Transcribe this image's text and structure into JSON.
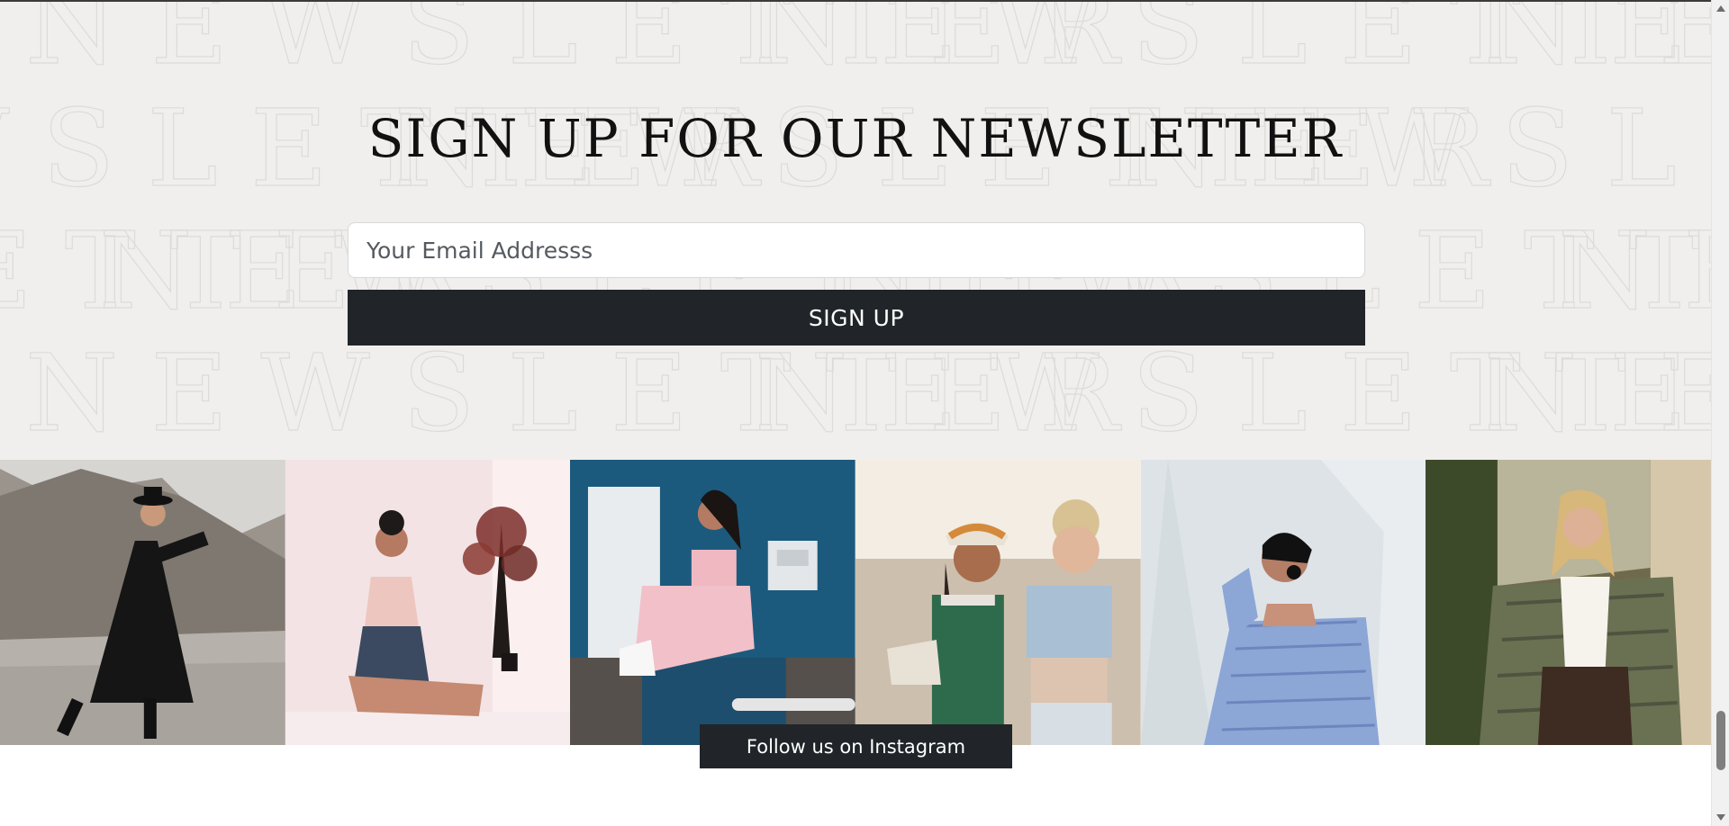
{
  "newsletter": {
    "background_word": "NEWSLETTER",
    "headline": "SIGN UP FOR OUR NEWSLETTER",
    "email_placeholder": "Your Email Addresss",
    "signup_label": "SIGN UP"
  },
  "gallery": {
    "photos": [
      "woman-black-dress-quarry-photo",
      "woman-pink-top-sitting-photo",
      "woman-pink-outfit-blue-wall-photo",
      "two-friends-smiling-photo",
      "woman-blue-striped-shirt-photo",
      "woman-tweed-blazer-photo"
    ],
    "follow_label": "Follow us on Instagram"
  },
  "colors": {
    "newsletter_bg": "#f0efed",
    "button_dark": "#212529",
    "headline_text": "#111111"
  }
}
